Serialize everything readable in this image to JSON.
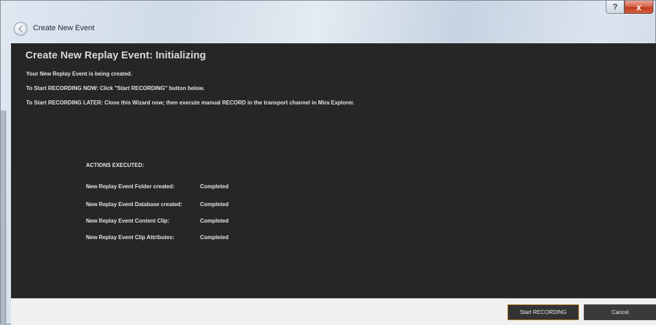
{
  "window": {
    "title": "Create New Event",
    "help_label": "?",
    "close_label": "x"
  },
  "main": {
    "heading": "Create New Replay Event: Initializing",
    "lines": [
      "Your New Replay Event is being created.",
      "To Start RECORDING NOW: Click \"Start RECORDING\" button below.",
      "To Start RECORDING LATER: Close this Wizard now; then execute manual RECORD in the transport channel in Mira Explorer."
    ],
    "actions_header": "ACTIONS EXECUTED:",
    "actions": [
      {
        "name": "New Replay Event Folder created:",
        "status": "Completed"
      },
      {
        "name": "New Replay Event Database created:",
        "status": "Completed"
      },
      {
        "name": "New Replay Event Content Clip:",
        "status": "Completed"
      },
      {
        "name": "New Replay Event Clip Attributes:",
        "status": "Completed"
      }
    ]
  },
  "footer": {
    "start_label": "Start RECORDING",
    "cancel_label": "Cancel"
  },
  "colors": {
    "panel_background": "#262626",
    "start_button_border": "#b77b2b",
    "close_button": "#c13b1f"
  },
  "icons": {
    "back": "back-arrow-icon",
    "help": "help-icon",
    "close": "close-icon"
  }
}
